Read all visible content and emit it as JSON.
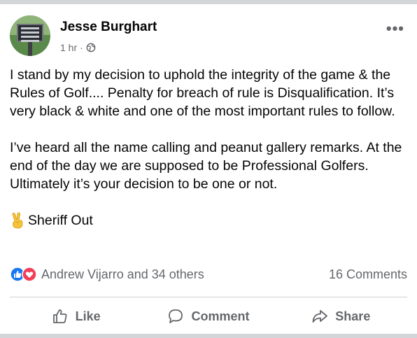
{
  "post": {
    "author": "Jesse Burghart",
    "time": "1 hr",
    "separator": "·",
    "more": "•••",
    "paragraphs": [
      "I stand by my decision to uphold the integrity of the game & the Rules of Golf.... Penalty for breach of rule is Disqualification. It’s very black & white and one of the most important rules to follow.",
      "I’ve heard all the name calling and peanut gallery remarks. At the end of the day we are supposed to be Professional Golfers. Ultimately it’s your decision to be one or not."
    ],
    "signoff": "Sheriff Out"
  },
  "stats": {
    "reactions_text": "Andrew Vijarro and 34 others",
    "comments_text": "16 Comments"
  },
  "actions": {
    "like": "Like",
    "comment": "Comment",
    "share": "Share"
  },
  "colors": {
    "like_blue": "#1877f2",
    "love_red": "#f33e58",
    "muted": "#65676b"
  }
}
